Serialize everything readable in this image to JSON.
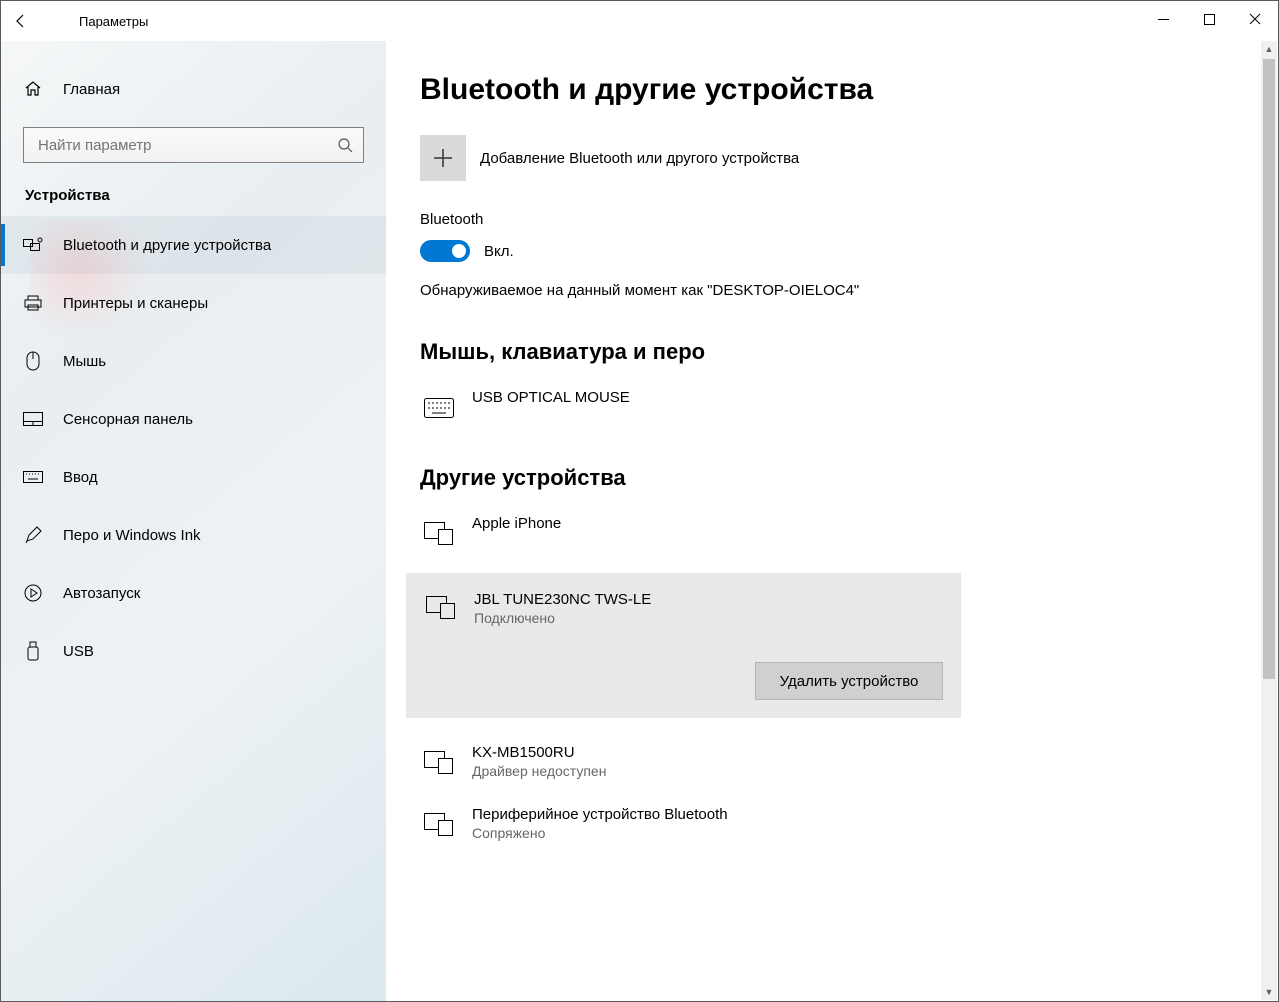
{
  "window": {
    "title": "Параметры"
  },
  "sidebar": {
    "home": "Главная",
    "search_placeholder": "Найти параметр",
    "category": "Устройства",
    "items": [
      {
        "label": "Bluetooth и другие устройства"
      },
      {
        "label": "Принтеры и сканеры"
      },
      {
        "label": "Мышь"
      },
      {
        "label": "Сенсорная панель"
      },
      {
        "label": "Ввод"
      },
      {
        "label": "Перо и Windows Ink"
      },
      {
        "label": "Автозапуск"
      },
      {
        "label": "USB"
      }
    ]
  },
  "main": {
    "title": "Bluetooth и другие устройства",
    "add_device": "Добавление Bluetooth или другого устройства",
    "bluetooth_label": "Bluetooth",
    "toggle_state": "Вкл.",
    "discoverable": "Обнаруживаемое на данный момент как \"DESKTOP-OIELOC4\"",
    "section_mouse": "Мышь, клавиатура и перо",
    "device_mouse": {
      "name": "USB OPTICAL MOUSE"
    },
    "section_other": "Другие устройства",
    "other_devices": [
      {
        "name": "Apple iPhone",
        "status": ""
      },
      {
        "name": "JBL TUNE230NC TWS-LE",
        "status": "Подключено",
        "selected": true
      },
      {
        "name": "KX-MB1500RU",
        "status": "Драйвер недоступен"
      },
      {
        "name": "Периферийное устройство Bluetooth",
        "status": "Сопряжено"
      }
    ],
    "remove_button": "Удалить устройство"
  }
}
